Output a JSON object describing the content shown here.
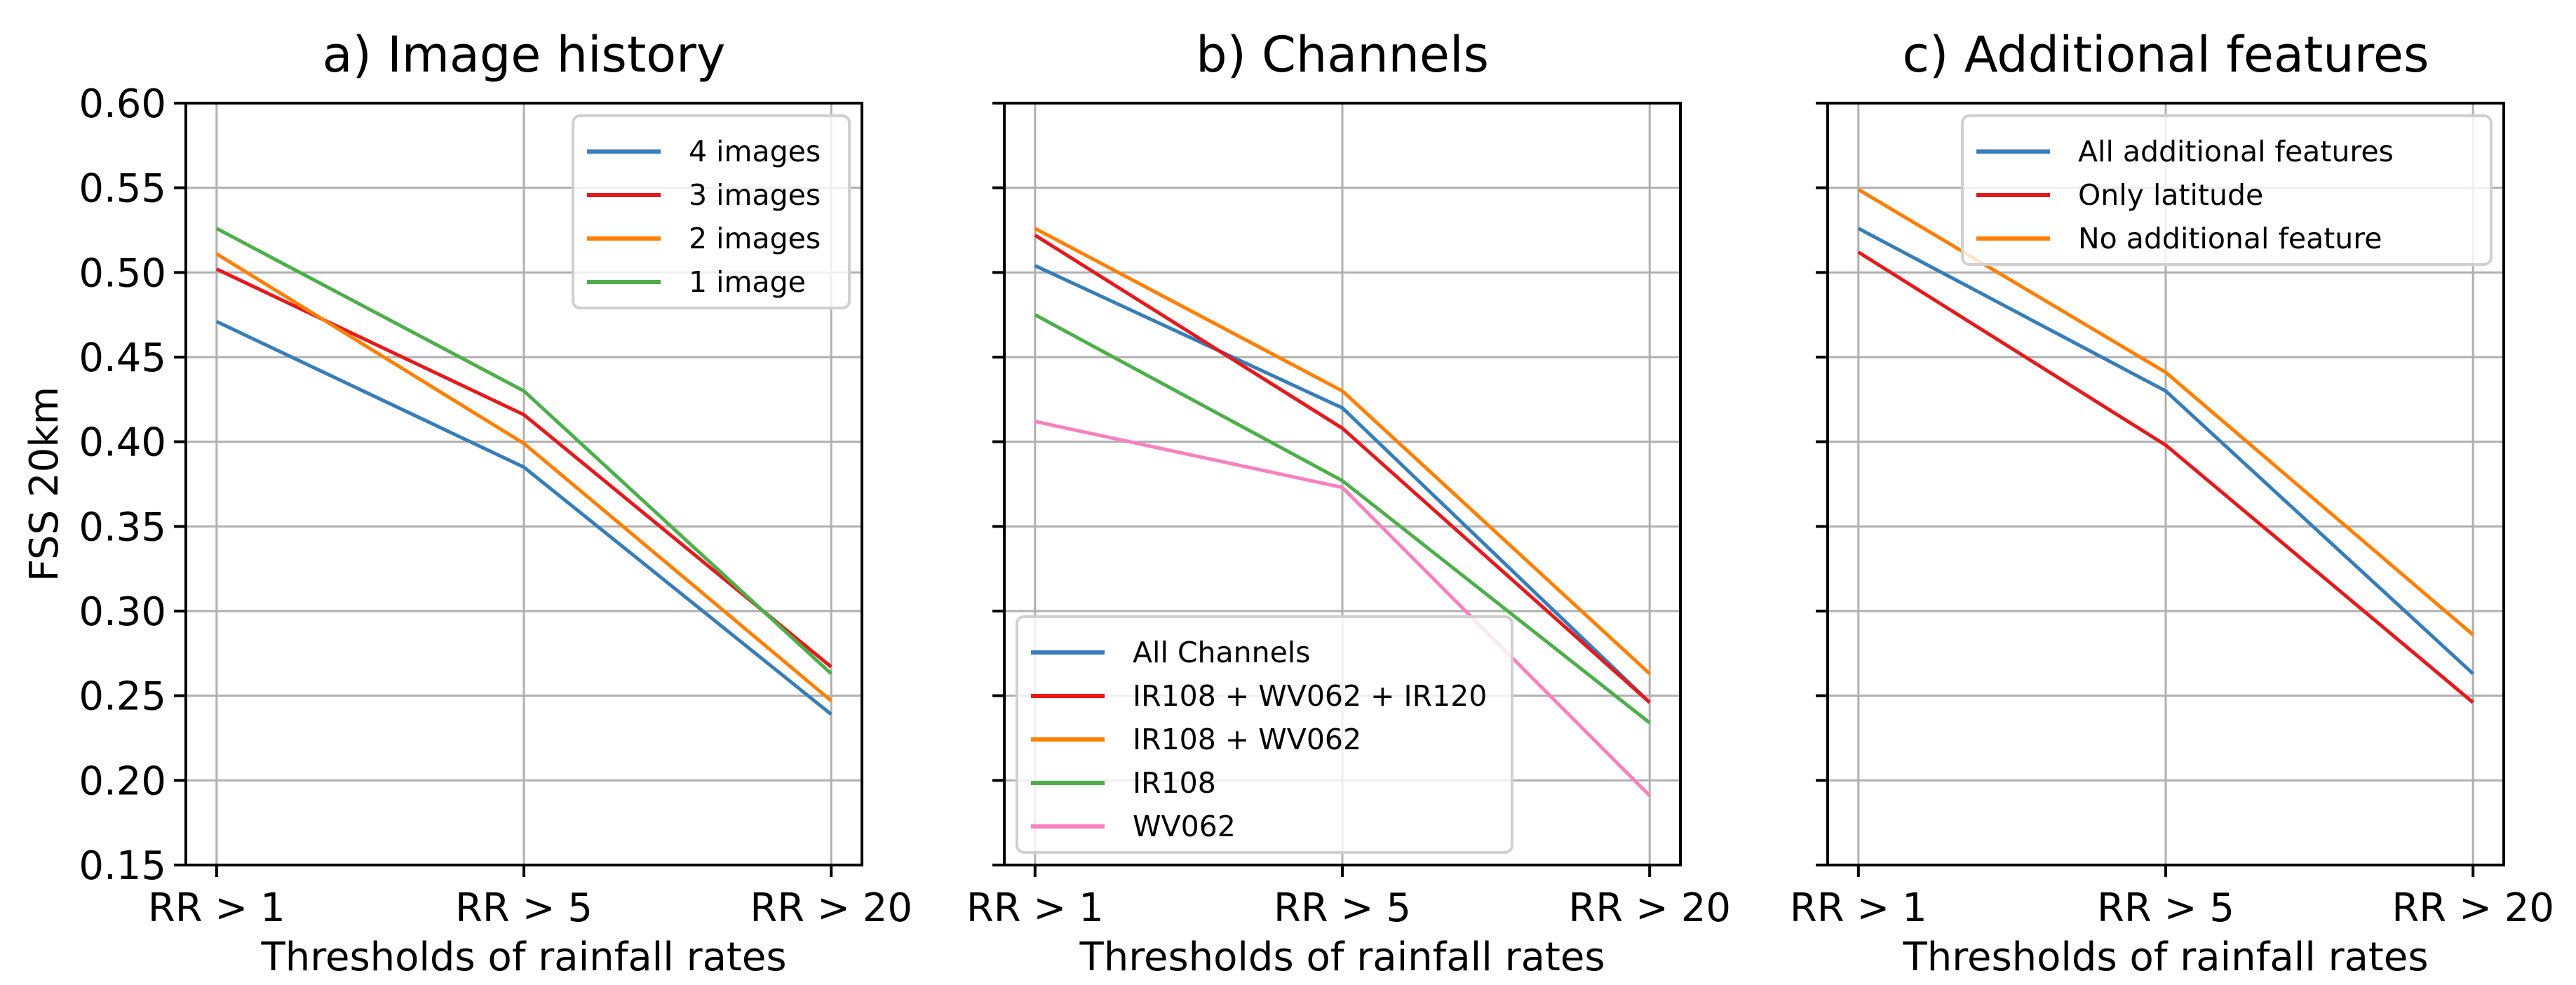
{
  "figure": {
    "ylabel": "FSS 20km",
    "xlabel": "Thresholds of rainfall rates"
  },
  "colors": {
    "blue": "#377eb8",
    "red": "#e41a1c",
    "orange": "#ff7f00",
    "green": "#4daf4a",
    "pink": "#f781bf"
  },
  "chart_data": [
    {
      "type": "line",
      "title": "a) Image history",
      "xlabel": "Thresholds of rainfall rates",
      "ylabel": "FSS 20km",
      "categories": [
        "RR > 1",
        "RR > 5",
        "RR > 20"
      ],
      "ylim": [
        0.15,
        0.6
      ],
      "yticks": [
        "0.15",
        "0.20",
        "0.25",
        "0.30",
        "0.35",
        "0.40",
        "0.45",
        "0.50",
        "0.55",
        "0.60"
      ],
      "grid": true,
      "legend_position": "upper-right",
      "series": [
        {
          "name": "4 images",
          "color": "#377eb8",
          "values": [
            0.471,
            0.385,
            0.239
          ]
        },
        {
          "name": "3 images",
          "color": "#e41a1c",
          "values": [
            0.502,
            0.416,
            0.267
          ]
        },
        {
          "name": "2 images",
          "color": "#ff7f00",
          "values": [
            0.511,
            0.399,
            0.247
          ]
        },
        {
          "name": "1 image",
          "color": "#4daf4a",
          "values": [
            0.526,
            0.43,
            0.263
          ]
        }
      ]
    },
    {
      "type": "line",
      "title": "b) Channels",
      "xlabel": "Thresholds of rainfall rates",
      "ylabel": "",
      "categories": [
        "RR > 1",
        "RR > 5",
        "RR > 20"
      ],
      "ylim": [
        0.15,
        0.6
      ],
      "yticks": [],
      "grid": true,
      "legend_position": "lower-left",
      "series": [
        {
          "name": "All Channels",
          "color": "#377eb8",
          "values": [
            0.504,
            0.42,
            0.246
          ]
        },
        {
          "name": "IR108 + WV062 + IR120",
          "color": "#e41a1c",
          "values": [
            0.522,
            0.408,
            0.246
          ]
        },
        {
          "name": "IR108 + WV062",
          "color": "#ff7f00",
          "values": [
            0.526,
            0.43,
            0.263
          ]
        },
        {
          "name": "IR108",
          "color": "#4daf4a",
          "values": [
            0.475,
            0.377,
            0.234
          ]
        },
        {
          "name": "WV062",
          "color": "#f781bf",
          "values": [
            0.412,
            0.373,
            0.191
          ]
        }
      ]
    },
    {
      "type": "line",
      "title": "c) Additional features",
      "xlabel": "Thresholds of rainfall rates",
      "ylabel": "",
      "categories": [
        "RR > 1",
        "RR > 5",
        "RR > 20"
      ],
      "ylim": [
        0.15,
        0.6
      ],
      "yticks": [],
      "grid": true,
      "legend_position": "upper-right",
      "series": [
        {
          "name": "All additional features",
          "color": "#377eb8",
          "values": [
            0.526,
            0.43,
            0.263
          ]
        },
        {
          "name": "Only latitude",
          "color": "#e41a1c",
          "values": [
            0.512,
            0.398,
            0.246
          ]
        },
        {
          "name": "No additional feature",
          "color": "#ff7f00",
          "values": [
            0.549,
            0.441,
            0.286
          ]
        }
      ]
    }
  ]
}
